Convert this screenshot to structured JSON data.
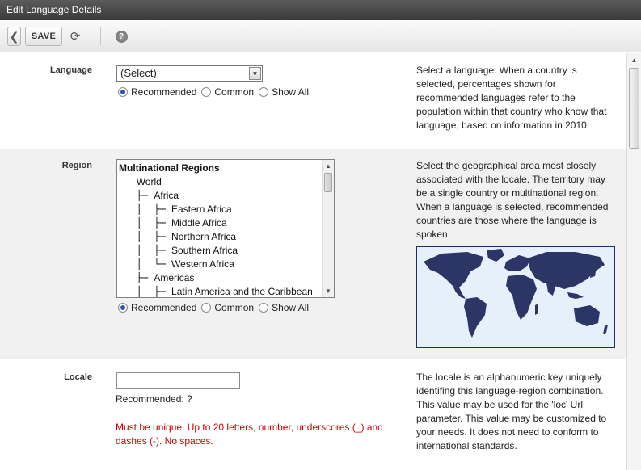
{
  "window": {
    "title": "Edit Language Details"
  },
  "toolbar": {
    "back_icon": "chevron-left-icon",
    "save_label": "SAVE",
    "refresh_icon": "refresh-icon",
    "help_icon": "help-icon",
    "help_glyph": "?"
  },
  "language": {
    "label": "Language",
    "select_value": "(Select)",
    "radios": [
      {
        "label": "Recommended",
        "checked": true
      },
      {
        "label": "Common",
        "checked": false
      },
      {
        "label": "Show All",
        "checked": false
      }
    ],
    "help": "Select a language. When a country is selected, percentages shown for recommended languages refer to the population within that country who know that language, based on information in 2010."
  },
  "region": {
    "label": "Region",
    "list": [
      {
        "prefix": "",
        "text": "Multinational Regions",
        "header": true
      },
      {
        "prefix": "   ",
        "text": "World"
      },
      {
        "prefix": "   ├─ ",
        "text": "Africa"
      },
      {
        "prefix": "   │  ├─ ",
        "text": "Eastern Africa"
      },
      {
        "prefix": "   │  ├─ ",
        "text": "Middle Africa"
      },
      {
        "prefix": "   │  ├─ ",
        "text": "Northern Africa"
      },
      {
        "prefix": "   │  ├─ ",
        "text": "Southern Africa"
      },
      {
        "prefix": "   │  └─ ",
        "text": "Western Africa"
      },
      {
        "prefix": "   ├─ ",
        "text": "Americas"
      },
      {
        "prefix": "   │  ├─ ",
        "text": "Latin America and the Caribbean"
      }
    ],
    "radios": [
      {
        "label": "Recommended",
        "checked": true
      },
      {
        "label": "Common",
        "checked": false
      },
      {
        "label": "Show All",
        "checked": false
      }
    ],
    "help": "Select the geographical area most closely associated with the locale. The territory may be a single country or multinational region. When a language is selected, recommended countries are those where the language is spoken.",
    "map_colors": {
      "ocean": "#e6f0fb",
      "land": "#2b3566"
    }
  },
  "locale": {
    "label": "Locale",
    "input_value": "",
    "recommended_text": "Recommended: ?",
    "error": "Must be unique. Up to 20 letters, number, underscores (_) and dashes (-). No spaces.",
    "help": "The locale is an alphanumeric key uniquely identifing this language-region combination. This value may be used for the 'loc' Url parameter. This value may be customized to your needs. It does not need to conform to international standards."
  }
}
